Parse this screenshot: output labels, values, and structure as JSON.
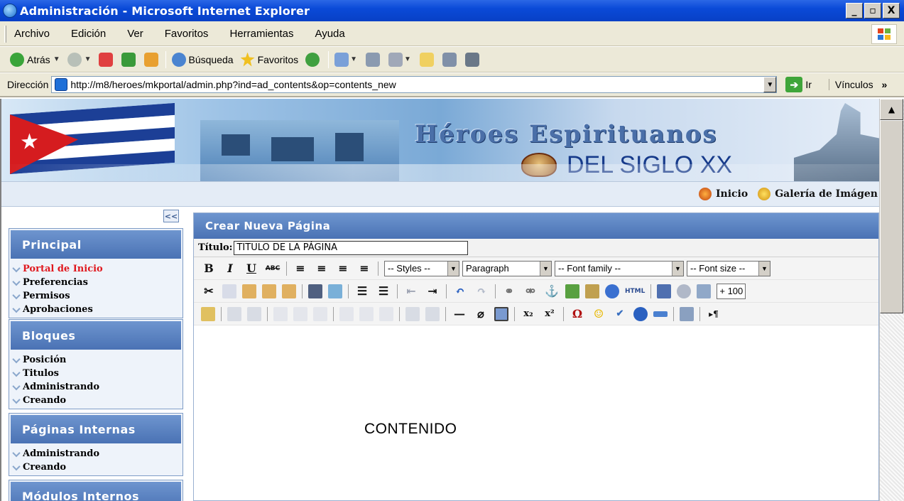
{
  "window": {
    "title": "Administración - Microsoft Internet Explorer",
    "controls": [
      "_",
      "ð",
      "X"
    ]
  },
  "menu": [
    "Archivo",
    "Edición",
    "Ver",
    "Favoritos",
    "Herramientas",
    "Ayuda"
  ],
  "toolbar": {
    "back": "Atrás",
    "search": "Búsqueda",
    "favorites": "Favoritos"
  },
  "address": {
    "label": "Dirección",
    "url": "http://m8/heroes/mkportal/admin.php?ind=ad_contents&op=contents_new",
    "go": "Ir",
    "links": "Vínculos",
    "links_more": "»"
  },
  "banner": {
    "title": "Héroes Espirituanos",
    "subtitle": "DEL SIGLO XX"
  },
  "nav": {
    "home": "Inicio",
    "gallery": "Galería de Imágen"
  },
  "sidebar": {
    "collapse_label": "<<",
    "sections": [
      {
        "title": "Principal",
        "items": [
          "Portal de Inicio",
          "Preferencias",
          "Permisos",
          "Aprobaciones"
        ]
      },
      {
        "title": "Bloques",
        "items": [
          "Posición",
          "Titulos",
          "Administrando",
          "Creando"
        ]
      },
      {
        "title": "Páginas Internas",
        "items": [
          "Administrando",
          "Creando"
        ]
      },
      {
        "title": "Módulos Internos",
        "items": []
      }
    ]
  },
  "main": {
    "header": "Crear Nueva Página",
    "title_label": "Título:",
    "title_value": "TITULO DE LA PÁGINA",
    "editor": {
      "styles": "-- Styles --",
      "format": "Paragraph",
      "font_family": "-- Font family --",
      "font_size": "-- Font size --",
      "zoom": "+ 100",
      "bold": "B",
      "italic": "I",
      "underline": "U",
      "strike": "ABC",
      "html": "HTML",
      "omega": "Ω",
      "sub": "x₂",
      "sup": "x²"
    },
    "content": "CONTENIDO"
  }
}
